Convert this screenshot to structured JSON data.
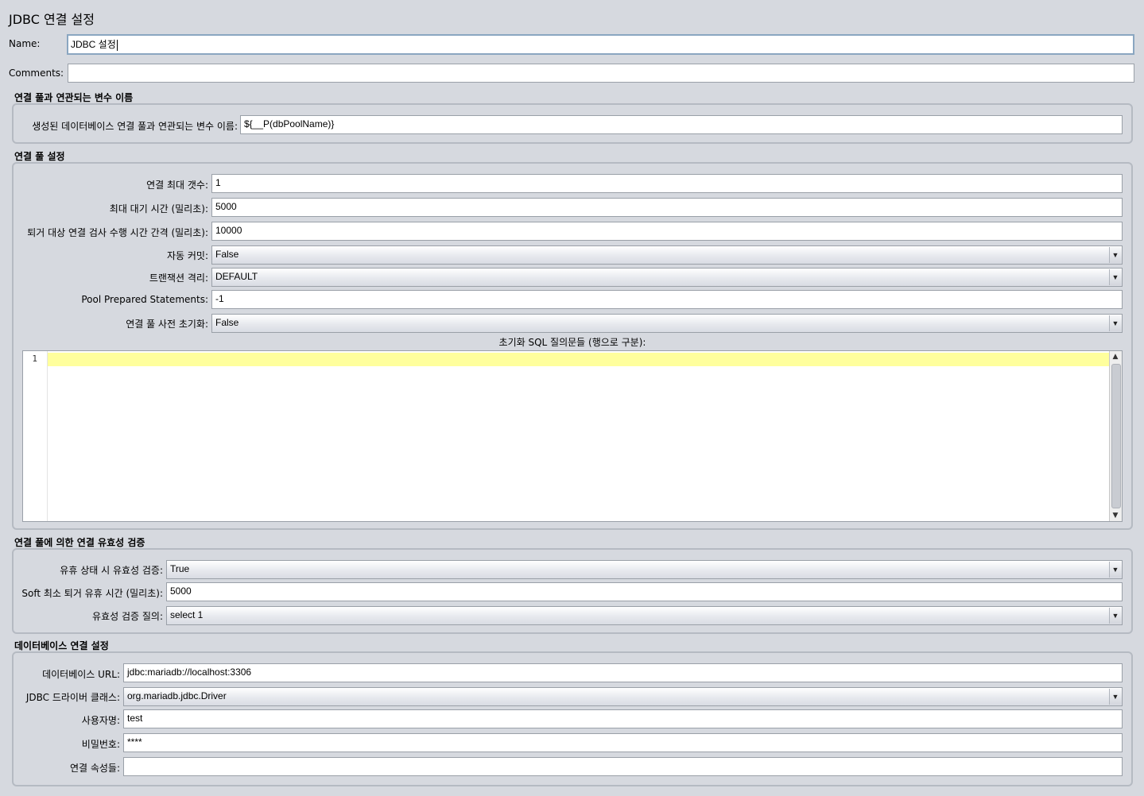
{
  "window_title": "JDBC 연결 설정",
  "name": {
    "label": "Name:",
    "value": "JDBC 설정"
  },
  "comments": {
    "label": "Comments:",
    "value": ""
  },
  "variable_section": {
    "title": "연결 풀과 연관되는 변수 이름",
    "label": "생성된 데이터베이스 연결 풀과 연관되는 변수 이름:",
    "value": "${__P(dbPoolName)}"
  },
  "pool_section": {
    "title": "연결 풀 설정",
    "max_connections": {
      "label": "연결 최대 갯수:",
      "value": "1"
    },
    "max_wait": {
      "label": "최대 대기 시간 (밀리초):",
      "value": "5000"
    },
    "eviction_interval": {
      "label": "퇴거 대상 연결 검사 수행 시간 간격 (밀리초):",
      "value": "10000"
    },
    "auto_commit": {
      "label": "자동 커밋:",
      "value": "False"
    },
    "isolation": {
      "label": "트랜잭션 격리:",
      "value": "DEFAULT"
    },
    "pool_prepared": {
      "label": "Pool Prepared Statements:",
      "value": "-1"
    },
    "preinit": {
      "label": "연결 풀 사전 초기화:",
      "value": "False"
    },
    "init_sql": {
      "label": "초기화 SQL 질의문들 (행으로 구분):",
      "line_number": "1"
    }
  },
  "validation_section": {
    "title": "연결 풀에 의한 연결 유효성 검증",
    "test_while_idle": {
      "label": "유휴 상태 시 유효성 검증:",
      "value": "True"
    },
    "soft_min_evictable": {
      "label": "Soft 최소 퇴거 유휴 시간 (밀리초):",
      "value": "5000"
    },
    "validation_query": {
      "label": "유효성 검증 질의:",
      "value": "select 1"
    }
  },
  "db_section": {
    "title": "데이터베이스 연결 설정",
    "url": {
      "label": "데이터베이스 URL:",
      "value": "jdbc:mariadb://localhost:3306"
    },
    "driver": {
      "label": "JDBC 드라이버 클래스:",
      "value": "org.mariadb.jdbc.Driver"
    },
    "username": {
      "label": "사용자명:",
      "value": "test"
    },
    "password": {
      "label": "비밀번호:",
      "value": "****"
    },
    "properties": {
      "label": "연결 속성들:",
      "value": ""
    }
  }
}
